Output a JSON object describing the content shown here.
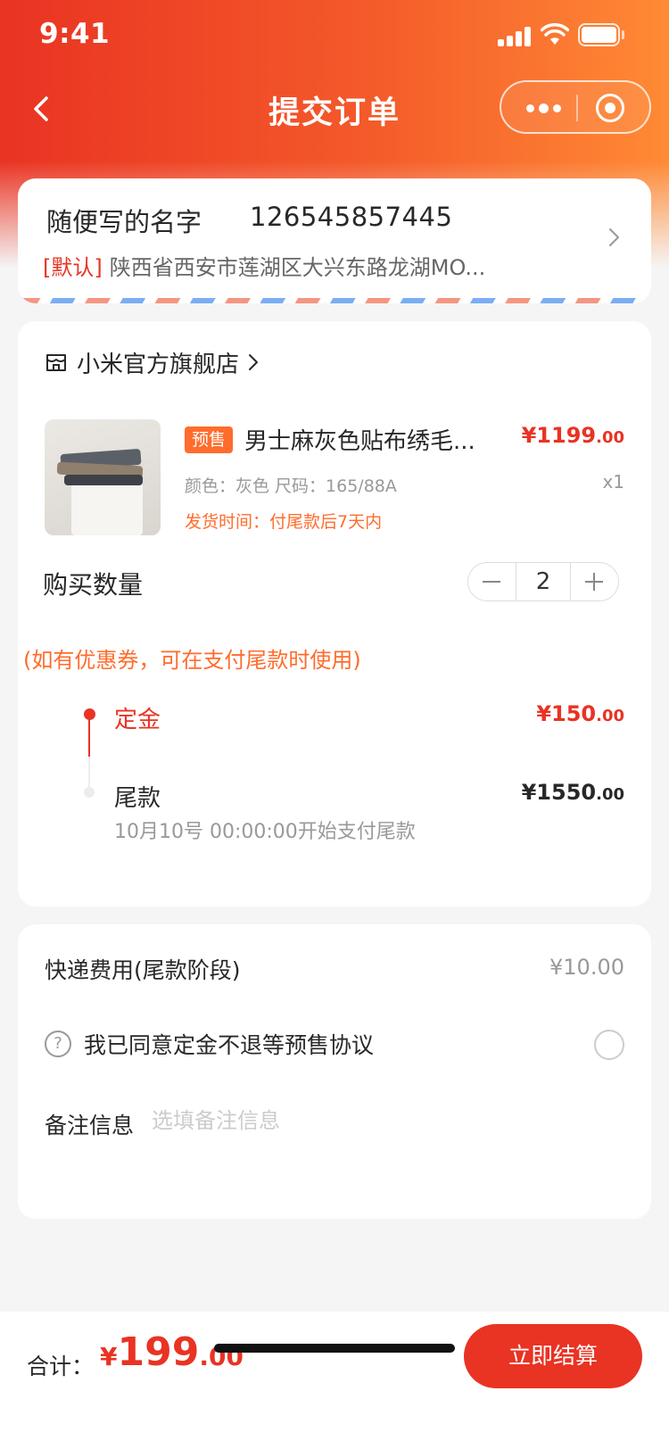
{
  "status_bar": {
    "time": "9:41"
  },
  "nav": {
    "title": "提交订单"
  },
  "address": {
    "name": "随便写的名字",
    "phone": "126545857445",
    "default_tag": "[默认]",
    "detail": "陕西省西安市莲湖区大兴东路龙湖MO..."
  },
  "store": {
    "name": "小米官方旗舰店"
  },
  "product": {
    "tag": "预售",
    "name": "男士麻灰色贴布绣毛...",
    "price_int": "¥1199",
    "price_dec": ".00",
    "attrs": "颜色：灰色  尺码：165/88A",
    "quantity": "x1",
    "ship_time": "发货时间：付尾款后7天内"
  },
  "purchase": {
    "qty_label": "购买数量",
    "qty_value": "2",
    "coupon_note": "(如有优惠券，可在支付尾款时使用)"
  },
  "payment": {
    "deposit_label": "定金",
    "deposit_int": "¥150",
    "deposit_dec": ".00",
    "balance_label": "尾款",
    "balance_int": "¥1550",
    "balance_dec": ".00",
    "balance_time": "10月10号 00:00:00开始支付尾款"
  },
  "extra": {
    "shipping_label": "快递费用(尾款阶段)",
    "shipping_value": "¥10.00",
    "agree_text": "我已同意定金不退等预售协议",
    "note_label": "备注信息",
    "note_placeholder": "选填备注信息"
  },
  "footer": {
    "total_label": "合计：",
    "total_currency": "¥",
    "total_int": "199",
    "total_dec": ".00",
    "checkout_label": "立即结算"
  },
  "colors": {
    "primary": "#e93323",
    "accent": "#ff6c2c"
  },
  "icons": [
    "back-icon",
    "more-dots-icon",
    "target-icon",
    "chevron-right-icon",
    "store-icon",
    "help-icon",
    "minus-icon",
    "plus-icon"
  ]
}
